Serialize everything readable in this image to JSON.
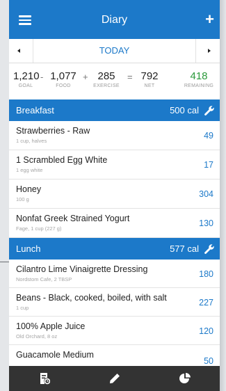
{
  "topbar": {
    "title": "Diary",
    "menu_icon": "hamburger-icon",
    "add_icon": "plus-icon",
    "add_label": "+"
  },
  "datebar": {
    "label": "TODAY",
    "prev_icon": "triangle-left-icon",
    "next_icon": "triangle-right-icon"
  },
  "summary": {
    "goal": {
      "value": "1,210",
      "label": "GOAL"
    },
    "minus": "-",
    "food": {
      "value": "1,077",
      "label": "FOOD"
    },
    "plus": "+",
    "exercise": {
      "value": "285",
      "label": "EXERCISE"
    },
    "equals": "=",
    "net": {
      "value": "792",
      "label": "NET"
    },
    "remaining": {
      "value": "418",
      "label": "REMAINING",
      "color": "#2c9a3c"
    }
  },
  "breakfast": {
    "title": "Breakfast",
    "calories": "500 cal",
    "items": [
      {
        "name": "Strawberries - Raw",
        "detail": "1 cup, halves",
        "calories": "49"
      },
      {
        "name": "1 Scrambled Egg White",
        "detail": "1 egg white",
        "calories": "17"
      },
      {
        "name": "Honey",
        "detail": "100 g",
        "calories": "304"
      },
      {
        "name": "Nonfat Greek Strained Yogurt",
        "detail": "Fage, 1 cup (227 g)",
        "calories": "130"
      }
    ]
  },
  "lunch": {
    "title": "Lunch",
    "calories": "577 cal",
    "items": [
      {
        "name": "Cilantro Lime Vinaigrette Dressing",
        "detail": "Nordstom Cafe, 2 TBSP",
        "calories": "180"
      },
      {
        "name": "Beans - Black, cooked, boiled, with salt",
        "detail": "1 cup",
        "calories": "227"
      },
      {
        "name": "100% Apple Juice",
        "detail": "Old Orchard, 8 oz",
        "calories": "120"
      },
      {
        "name": "Guacamole Medium",
        "detail": "",
        "calories": "50"
      }
    ]
  },
  "tabbar": {
    "icons": [
      "diary-icon",
      "pencil-icon",
      "pie-chart-icon"
    ]
  },
  "colors": {
    "primary": "#1c79c9",
    "tabbar": "#333333",
    "remaining": "#2c9a3c"
  }
}
